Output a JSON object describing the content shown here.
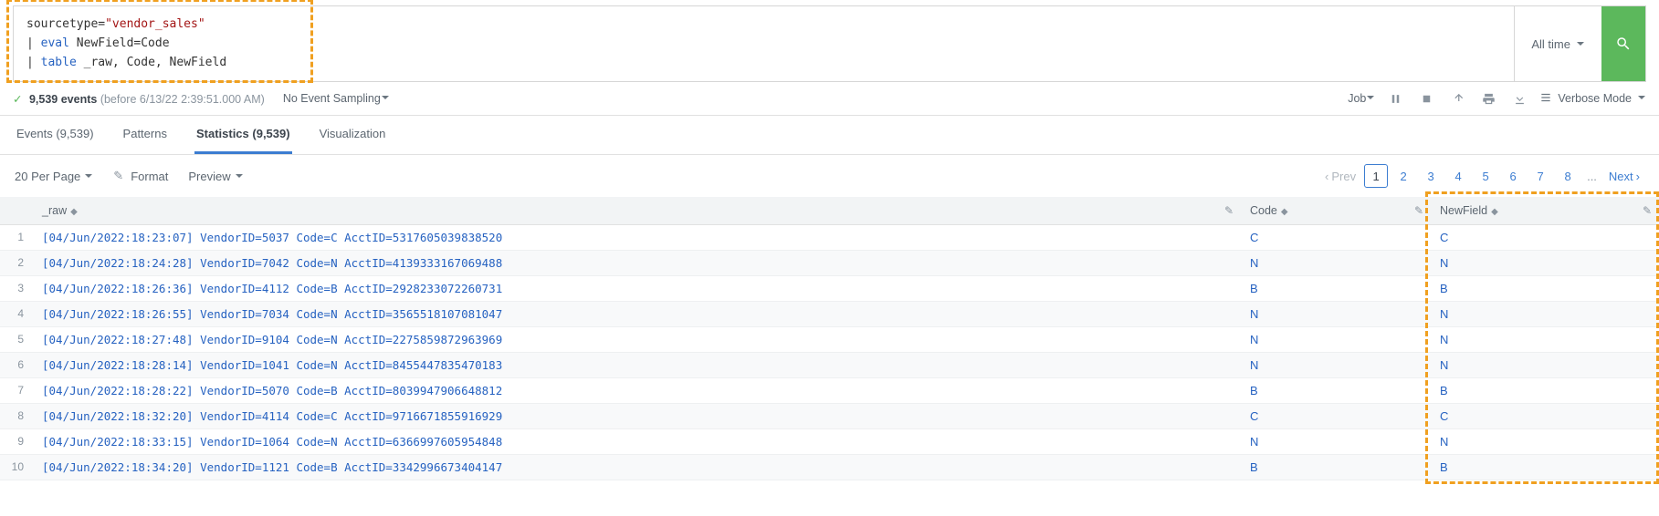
{
  "search": {
    "line1_pre": "sourcetype=",
    "line1_str": "\"vendor_sales\"",
    "line2_pipe": "| ",
    "line2_kw": "eval",
    "line2_rest": " NewField=Code",
    "line3_pipe": "| ",
    "line3_kw": "table",
    "line3_rest": " _raw, Code, NewField"
  },
  "time_picker": "All time",
  "status": {
    "count": "9,539 events",
    "sub": "(before 6/13/22 2:39:51.000 AM)",
    "sampling": "No Event Sampling"
  },
  "job_label": "Job",
  "mode_label": "Verbose Mode",
  "tabs": {
    "events": "Events (9,539)",
    "patterns": "Patterns",
    "statistics": "Statistics (9,539)",
    "visualization": "Visualization"
  },
  "toolbar": {
    "per_page": "20 Per Page",
    "format": "Format",
    "preview": "Preview"
  },
  "pager": {
    "prev": "Prev",
    "next": "Next",
    "pages": [
      "1",
      "2",
      "3",
      "4",
      "5",
      "6",
      "7",
      "8"
    ],
    "ellipsis": "..."
  },
  "columns": {
    "raw": "_raw",
    "code": "Code",
    "newfield": "NewField"
  },
  "rows": [
    {
      "idx": "1",
      "raw": "[04/Jun/2022:18:23:07] VendorID=5037 Code=C AcctID=5317605039838520",
      "code": "C",
      "new": "C"
    },
    {
      "idx": "2",
      "raw": "[04/Jun/2022:18:24:28] VendorID=7042 Code=N AcctID=4139333167069488",
      "code": "N",
      "new": "N"
    },
    {
      "idx": "3",
      "raw": "[04/Jun/2022:18:26:36] VendorID=4112 Code=B AcctID=2928233072260731",
      "code": "B",
      "new": "B"
    },
    {
      "idx": "4",
      "raw": "[04/Jun/2022:18:26:55] VendorID=7034 Code=N AcctID=3565518107081047",
      "code": "N",
      "new": "N"
    },
    {
      "idx": "5",
      "raw": "[04/Jun/2022:18:27:48] VendorID=9104 Code=N AcctID=2275859872963969",
      "code": "N",
      "new": "N"
    },
    {
      "idx": "6",
      "raw": "[04/Jun/2022:18:28:14] VendorID=1041 Code=N AcctID=8455447835470183",
      "code": "N",
      "new": "N"
    },
    {
      "idx": "7",
      "raw": "[04/Jun/2022:18:28:22] VendorID=5070 Code=B AcctID=8039947906648812",
      "code": "B",
      "new": "B"
    },
    {
      "idx": "8",
      "raw": "[04/Jun/2022:18:32:20] VendorID=4114 Code=C AcctID=9716671855916929",
      "code": "C",
      "new": "C"
    },
    {
      "idx": "9",
      "raw": "[04/Jun/2022:18:33:15] VendorID=1064 Code=N AcctID=6366997605954848",
      "code": "N",
      "new": "N"
    },
    {
      "idx": "10",
      "raw": "[04/Jun/2022:18:34:20] VendorID=1121 Code=B AcctID=3342996673404147",
      "code": "B",
      "new": "B"
    }
  ]
}
